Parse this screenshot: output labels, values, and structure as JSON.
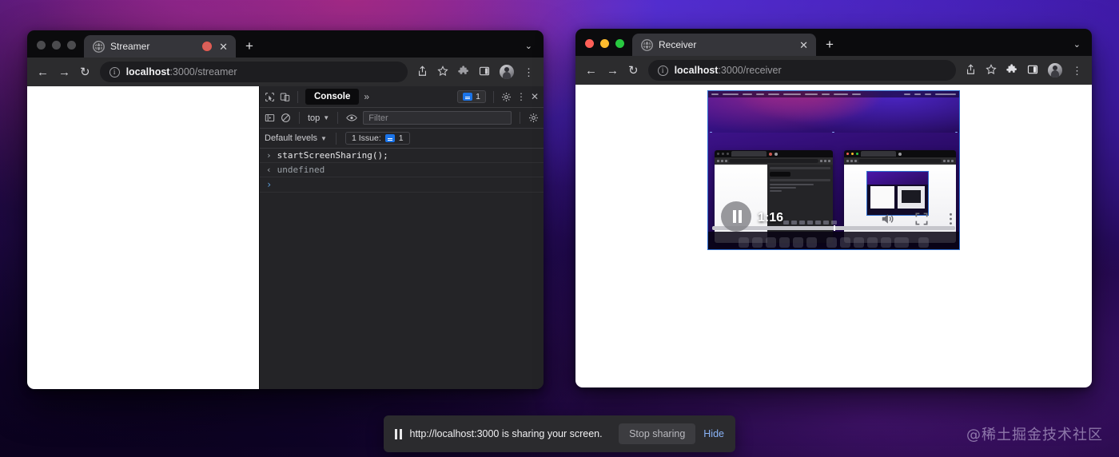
{
  "desktop": {
    "watermark": "@稀土掘金技术社区"
  },
  "streamer_window": {
    "tab": {
      "title": "Streamer",
      "favicon_icon": "globe-icon",
      "recording_icon": "record-dot-icon",
      "close_label": "✕"
    },
    "newtab_label": "+",
    "tablist_chevron": "⌄",
    "toolbar": {
      "back_icon": "←",
      "forward_icon": "→",
      "reload_icon": "↻",
      "info_icon": "i",
      "url_host": "localhost",
      "url_path": ":3000/streamer",
      "share_icon": "share-icon",
      "bookmark_icon": "star-icon",
      "extensions_icon": "puzzle-icon",
      "sidepanel_icon": "panel-icon",
      "avatar_icon": "avatar-icon",
      "menu_icon": "⋮"
    },
    "devtools": {
      "inspect_icon": "inspect-cursor-icon",
      "device_icon": "device-toolbar-icon",
      "active_tab": "Console",
      "more_tabs_label": "»",
      "issues_count": "1",
      "settings_icon": "gear-icon",
      "kebab_icon": "⋮",
      "close_icon": "✕",
      "sidebar_icon": "console-sidebar-icon",
      "clear_icon": "clear-console-icon",
      "context": "top",
      "eye_icon": "live-expression-icon",
      "filter_placeholder": "Filter",
      "filter_settings_icon": "gear-icon",
      "levels_label": "Default levels",
      "issue_pill_label": "1 Issue:",
      "issue_pill_count": "1",
      "console_lines": [
        {
          "marker": "›",
          "type": "input",
          "text": "startScreenSharing();"
        },
        {
          "marker": "‹",
          "type": "output",
          "text": "undefined"
        }
      ],
      "prompt_marker": "›"
    }
  },
  "receiver_window": {
    "tab": {
      "title": "Receiver",
      "favicon_icon": "globe-icon",
      "close_label": "✕"
    },
    "newtab_label": "+",
    "tablist_chevron": "⌄",
    "traffic_lights": [
      "close-red",
      "minimize-yellow",
      "zoom-green"
    ],
    "toolbar": {
      "back_icon": "←",
      "forward_icon": "→",
      "reload_icon": "↻",
      "info_icon": "i",
      "url_host": "localhost",
      "url_path": ":3000/receiver",
      "share_icon": "share-icon",
      "bookmark_icon": "star-icon",
      "extensions_icon": "puzzle-icon",
      "sidepanel_icon": "panel-icon",
      "avatar_icon": "avatar-icon",
      "menu_icon": "⋮"
    },
    "video": {
      "current_time": "1:16",
      "pause_icon": "pause-icon",
      "volume_icon": "volume-icon",
      "fullscreen_icon": "fullscreen-icon",
      "options_icon": "kebab-icon",
      "content_description": "shared-screen-recursive-view"
    }
  },
  "sharing_bar": {
    "pause_icon": "pause-icon",
    "message": "http://localhost:3000 is sharing your screen.",
    "stop_label": "Stop sharing",
    "hide_label": "Hide"
  },
  "colors": {
    "accent_blue": "#8ab4f8",
    "issue_blue": "#1a73e8",
    "recording_red": "#d9605a",
    "traffic_red": "#ff5f57",
    "traffic_yellow": "#febc2e",
    "traffic_green": "#28c840"
  }
}
